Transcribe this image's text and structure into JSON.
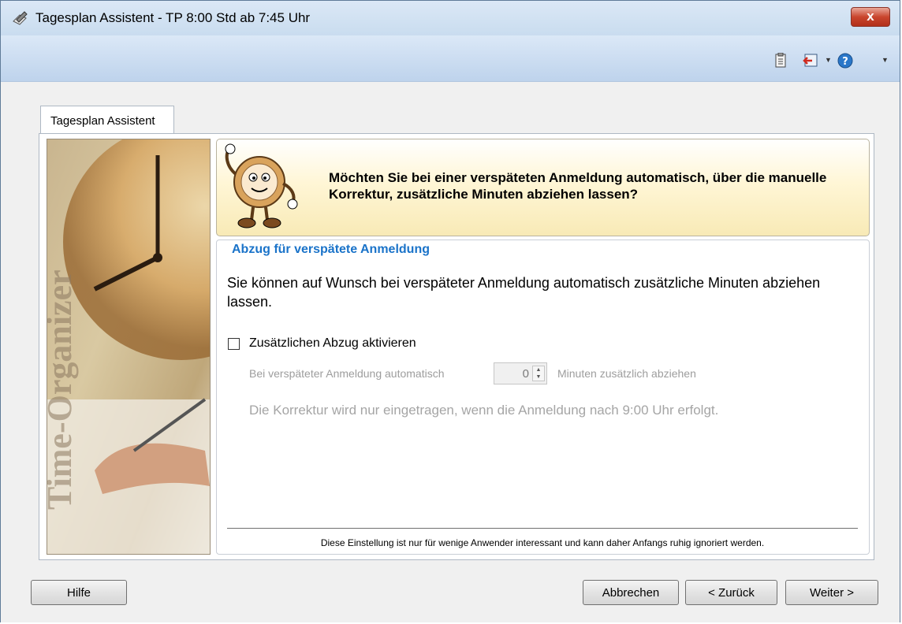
{
  "window": {
    "title": "Tagesplan Assistent - TP 8:00 Std ab 7:45 Uhr",
    "close_label": "x"
  },
  "toolbar": {
    "icons": [
      "clipboard-icon",
      "exit-icon",
      "help-icon"
    ],
    "dropdown_glyph": "▼"
  },
  "tab": {
    "label": "Tagesplan Assistent"
  },
  "side_image": {
    "text": "Time-Organizer"
  },
  "header": {
    "question": "Möchten Sie bei einer verspäteten Anmeldung automatisch, über die manuelle Korrektur, zusätzliche Minuten abziehen lassen?"
  },
  "group": {
    "title": "Abzug für verspätete Anmeldung",
    "description": "Sie können auf Wunsch bei verspäteter Anmeldung automatisch zusätzliche Minuten abziehen lassen.",
    "checkbox_label": "Zusätzlichen Abzug aktivieren",
    "checkbox_checked": false,
    "prefix_label": "Bei verspäteter Anmeldung automatisch",
    "minutes_value": "0",
    "suffix_label": "Minuten zusätzlich abziehen",
    "note": "Die Korrektur wird nur eingetragen, wenn die Anmeldung nach 9:00 Uhr erfolgt."
  },
  "footer_note": "Diese Einstellung ist nur für wenige Anwender interessant und kann daher Anfangs ruhig ignoriert werden.",
  "buttons": {
    "help": "Hilfe",
    "cancel": "Abbrechen",
    "back": "< Zurück",
    "next": "Weiter >"
  },
  "colors": {
    "group_title": "#1a73c9",
    "close_button": "#c9452d",
    "header_bg": "#fff6d6"
  }
}
